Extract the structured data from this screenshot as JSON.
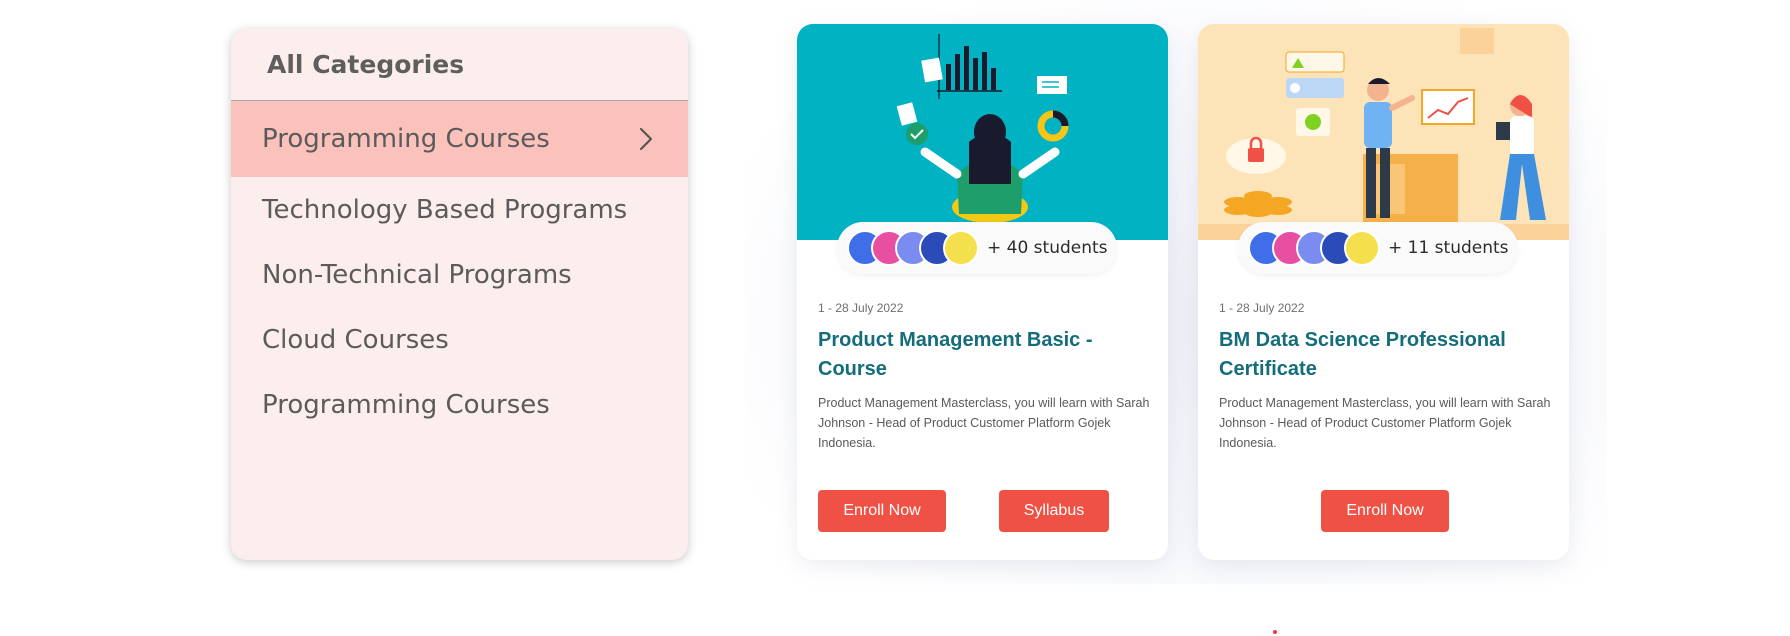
{
  "sidebar": {
    "title": "All Categories",
    "items": [
      {
        "label": "Programming Courses",
        "active": true
      },
      {
        "label": "Technology Based Programs",
        "active": false
      },
      {
        "label": "Non-Technical Programs",
        "active": false
      },
      {
        "label": "Cloud Courses",
        "active": false
      },
      {
        "label": "Programming Courses",
        "active": false
      }
    ]
  },
  "cards": [
    {
      "image_icon": "meditation-analytics-illustration",
      "students": "+ 40 students",
      "date": "1 - 28 July 2022",
      "title": "Product Management Basic - Course",
      "description": "Product Management Masterclass, you will learn with Sarah Johnson - Head of Product Customer Platform Gojek Indonesia.",
      "buttons": {
        "enroll": "Enroll Now",
        "syllabus": "Syllabus"
      }
    },
    {
      "image_icon": "data-science-team-illustration",
      "students": "+ 11 students",
      "date": "1 - 28 July 2022",
      "title": "BM Data Science Professional Certificate",
      "description": "Product Management Masterclass, you will learn with Sarah Johnson - Head of Product Customer Platform Gojek Indonesia.",
      "buttons": {
        "enroll": "Enroll Now"
      }
    }
  ],
  "colors": {
    "accent": "#ef5144",
    "title_teal": "#136d7a",
    "sidebar_bg": "#fdeeee",
    "sidebar_active": "#fbc1bb",
    "card1_image_bg": "#00b2c2",
    "card2_image_bg": "#fde3b8"
  }
}
